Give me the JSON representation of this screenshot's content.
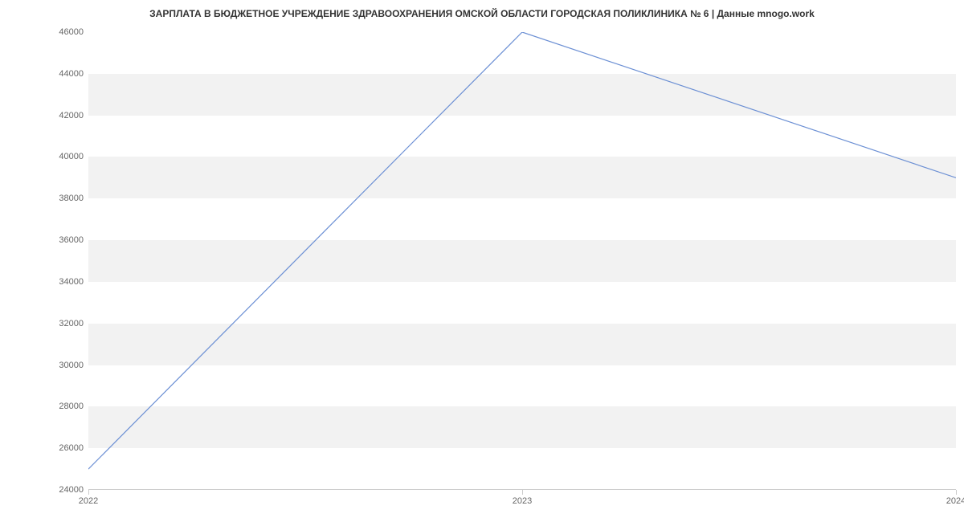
{
  "chart_data": {
    "type": "line",
    "title": "ЗАРПЛАТА В БЮДЖЕТНОЕ УЧРЕЖДЕНИЕ ЗДРАВООХРАНЕНИЯ ОМСКОЙ ОБЛАСТИ ГОРОДСКАЯ ПОЛИКЛИНИКА № 6 | Данные mnogo.work",
    "x": [
      "2022",
      "2023",
      "2024"
    ],
    "values": [
      25000,
      46000,
      39000
    ],
    "xlabel": "",
    "ylabel": "",
    "ylim": [
      24000,
      46000
    ],
    "y_ticks": [
      24000,
      26000,
      28000,
      30000,
      32000,
      34000,
      36000,
      38000,
      40000,
      42000,
      44000,
      46000
    ],
    "line_color": "#6b8fd4"
  }
}
